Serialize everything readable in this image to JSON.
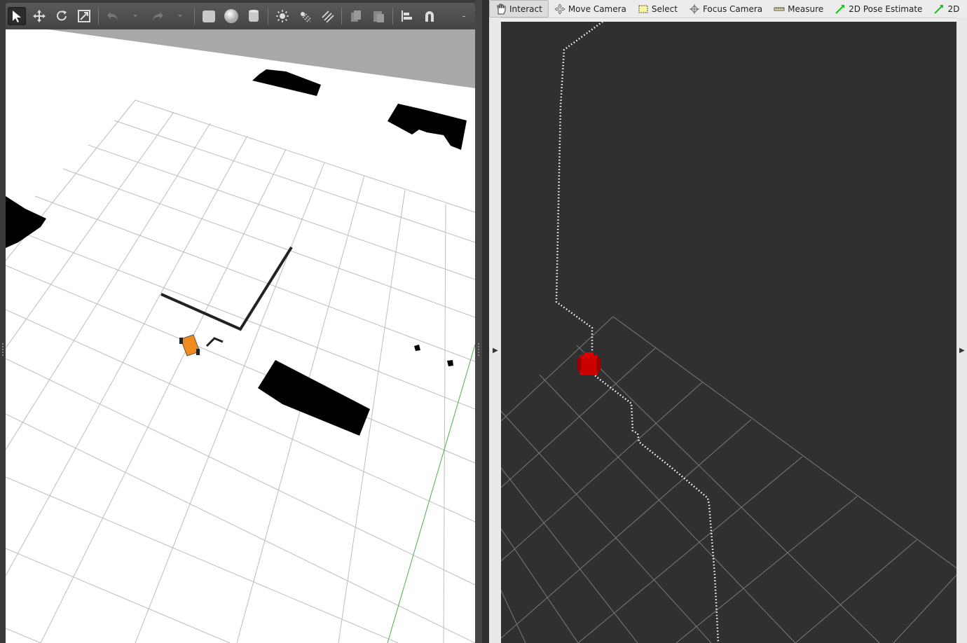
{
  "gazebo": {
    "toolbar": {
      "tools": [
        {
          "icon": "select-arrow-icon",
          "active": true
        },
        {
          "icon": "translate-icon"
        },
        {
          "icon": "rotate-icon"
        },
        {
          "icon": "scale-icon"
        },
        {
          "icon": "undo-icon"
        },
        {
          "icon": "undo-dropdown-icon"
        },
        {
          "icon": "redo-icon"
        },
        {
          "icon": "redo-dropdown-icon"
        },
        {
          "icon": "box-shape-icon"
        },
        {
          "icon": "sphere-shape-icon"
        },
        {
          "icon": "cylinder-shape-icon"
        },
        {
          "icon": "point-light-icon"
        },
        {
          "icon": "spot-light-icon"
        },
        {
          "icon": "directional-light-icon"
        },
        {
          "icon": "copy-icon"
        },
        {
          "icon": "paste-icon"
        },
        {
          "icon": "align-icon"
        },
        {
          "icon": "snap-magnet-icon"
        }
      ],
      "overflow_label": "-"
    },
    "colors": {
      "ground": "#ffffff",
      "grid": "#bdbdbd",
      "obstacle": "#000000",
      "robot": "#f08c1e",
      "axis": "#4caf50"
    }
  },
  "rviz": {
    "toolbar": {
      "tools": [
        {
          "label": "Interact",
          "icon": "hand-icon",
          "active": true
        },
        {
          "label": "Move Camera",
          "icon": "move-camera-icon"
        },
        {
          "label": "Select",
          "icon": "select-rect-icon"
        },
        {
          "label": "Focus Camera",
          "icon": "focus-camera-icon"
        },
        {
          "label": "Measure",
          "icon": "ruler-icon"
        },
        {
          "label": "2D Pose Estimate",
          "icon": "green-arrow-icon"
        },
        {
          "label": "2D",
          "icon": "green-arrow-icon"
        }
      ]
    },
    "colors": {
      "background": "#303030",
      "grid": "#7a7a7a",
      "path": "#ffffff",
      "robot": "#d40000"
    }
  }
}
